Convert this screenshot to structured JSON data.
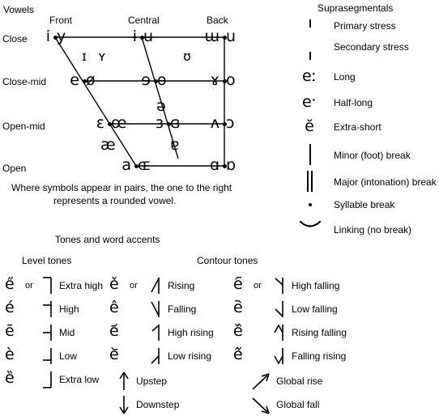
{
  "vowels": {
    "section_title": "Vowels",
    "column_headers": [
      "Front",
      "Central",
      "Back"
    ],
    "row_headers": [
      "Close",
      "Close-mid",
      "Open-mid",
      "Open"
    ],
    "caption_line1": "Where symbols appear in pairs, the one to the right",
    "caption_line2": "represents a rounded vowel.",
    "cells": [
      {
        "unrounded": "i",
        "rounded": "y",
        "position": "front-close"
      },
      {
        "unrounded": "ɨ",
        "rounded": "ʉ",
        "position": "central-close"
      },
      {
        "unrounded": "ɯ",
        "rounded": "u",
        "position": "back-close"
      },
      {
        "unrounded": "ɪ",
        "rounded": "ʏ",
        "position": "near-front-near-close"
      },
      {
        "unrounded": "ʊ",
        "rounded": "",
        "position": "near-back-near-close"
      },
      {
        "unrounded": "e",
        "rounded": "ø",
        "position": "front-close-mid"
      },
      {
        "unrounded": "ɘ",
        "rounded": "ɵ",
        "position": "central-close-mid"
      },
      {
        "unrounded": "ɤ",
        "rounded": "o",
        "position": "back-close-mid"
      },
      {
        "unrounded": "ə",
        "rounded": "",
        "position": "central-mid"
      },
      {
        "unrounded": "ɛ",
        "rounded": "œ",
        "position": "front-open-mid"
      },
      {
        "unrounded": "ɜ",
        "rounded": "ɞ",
        "position": "central-open-mid"
      },
      {
        "unrounded": "ʌ",
        "rounded": "ɔ",
        "position": "back-open-mid"
      },
      {
        "unrounded": "æ",
        "rounded": "",
        "position": "front-near-open"
      },
      {
        "unrounded": "ɐ",
        "rounded": "",
        "position": "central-near-open"
      },
      {
        "unrounded": "a",
        "rounded": "ɶ",
        "position": "front-open"
      },
      {
        "unrounded": "ɑ",
        "rounded": "ɒ",
        "position": "back-open"
      }
    ]
  },
  "suprasegmentals": {
    "section_title": "Suprasegmentals",
    "items": [
      {
        "symbol": "ˈ",
        "label": "Primary stress",
        "icon": "primary-stress-mark"
      },
      {
        "symbol": "ˌ",
        "label": "Secondary stress",
        "icon": "secondary-stress-mark"
      },
      {
        "symbol": "eː",
        "label": "Long",
        "icon": "length-mark"
      },
      {
        "symbol": "eˑ",
        "label": "Half-long",
        "icon": "half-length-mark"
      },
      {
        "symbol": "ĕ",
        "label": "Extra-short",
        "icon": "breve-mark"
      },
      {
        "symbol": "|",
        "label": "Minor (foot) break",
        "icon": "minor-break-bar"
      },
      {
        "symbol": "‖",
        "label": "Major (intonation) break",
        "icon": "major-break-double-bar"
      },
      {
        "symbol": ".",
        "label": "Syllable break",
        "icon": "syllable-break-dot"
      },
      {
        "symbol": "‿",
        "label": "Linking (no break)",
        "icon": "linking-tie-bar"
      }
    ]
  },
  "tones": {
    "section_title": "Tones and word accents",
    "level_heading": "Level tones",
    "contour_heading": "Contour tones",
    "or_label": "or",
    "level": [
      {
        "letter": "e̋",
        "name": "Extra high",
        "icon": "tone-bar-extra-high"
      },
      {
        "letter": "é",
        "name": "High",
        "icon": "tone-bar-high"
      },
      {
        "letter": "ē",
        "name": "Mid",
        "icon": "tone-bar-mid"
      },
      {
        "letter": "è",
        "name": "Low",
        "icon": "tone-bar-low"
      },
      {
        "letter": "ȅ",
        "name": "Extra low",
        "icon": "tone-bar-extra-low"
      }
    ],
    "contour_left": [
      {
        "letter": "ě",
        "name": "Rising",
        "icon": "tone-contour-rising"
      },
      {
        "letter": "ê",
        "name": "Falling",
        "icon": "tone-contour-falling"
      },
      {
        "letter": "e᷄",
        "name": "High rising",
        "icon": "tone-contour-high-rising"
      },
      {
        "letter": "e᷅",
        "name": "Low rising",
        "icon": "tone-contour-low-rising"
      }
    ],
    "contour_right": [
      {
        "letter": "e᷇",
        "name": "High falling",
        "icon": "tone-contour-high-falling"
      },
      {
        "letter": "e᷆",
        "name": "Low falling",
        "icon": "tone-contour-low-falling"
      },
      {
        "letter": "e᷈",
        "name": "Rising falling",
        "icon": "tone-contour-rising-falling"
      },
      {
        "letter": "e᷉",
        "name": "Falling rising",
        "icon": "tone-contour-falling-rising"
      }
    ],
    "steps": [
      {
        "name": "Upstep",
        "icon": "upstep-arrow"
      },
      {
        "name": "Downstep",
        "icon": "downstep-arrow"
      },
      {
        "name": "Global rise",
        "icon": "global-rise-arrow"
      },
      {
        "name": "Global fall",
        "icon": "global-fall-arrow"
      }
    ]
  },
  "colors": {
    "ink": "#000000",
    "background": "#ffffff"
  }
}
